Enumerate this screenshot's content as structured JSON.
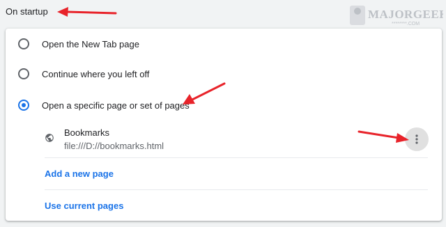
{
  "section_title": "On startup",
  "watermark": {
    "brand": "MAJORGEEKS",
    "suffix": "********.COM"
  },
  "startup_options": [
    {
      "label": "Open the New Tab page",
      "checked": false
    },
    {
      "label": "Continue where you left off",
      "checked": false
    },
    {
      "label": "Open a specific page or set of pages",
      "checked": true
    }
  ],
  "startup_pages": [
    {
      "title": "Bookmarks",
      "url": "file:///D://bookmarks.html",
      "icon": "globe-icon"
    }
  ],
  "actions": {
    "add_page": "Add a new page",
    "use_current": "Use current pages"
  },
  "colors": {
    "accent": "#1a73e8",
    "annotation_arrow": "#e8232a"
  }
}
